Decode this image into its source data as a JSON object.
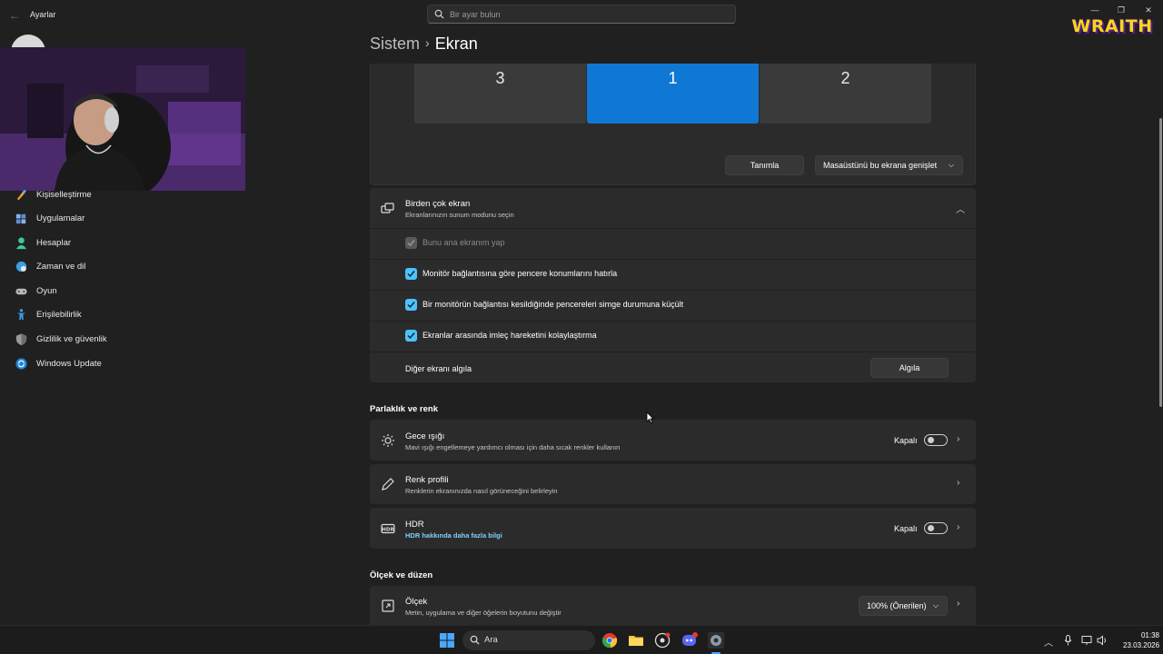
{
  "window": {
    "app_title": "Ayarlar",
    "search_placeholder": "Bir ayar bulun"
  },
  "logo_text": "WRAITH",
  "sidebar": {
    "items": [
      {
        "label": "Kişiselleştirme",
        "icon": "brush-icon"
      },
      {
        "label": "Uygulamalar",
        "icon": "apps-icon"
      },
      {
        "label": "Hesaplar",
        "icon": "person-icon"
      },
      {
        "label": "Zaman ve dil",
        "icon": "globe-clock-icon"
      },
      {
        "label": "Oyun",
        "icon": "gamepad-icon"
      },
      {
        "label": "Erişilebilirlik",
        "icon": "accessibility-icon"
      },
      {
        "label": "Gizlilik ve güvenlik",
        "icon": "shield-icon"
      },
      {
        "label": "Windows Update",
        "icon": "update-icon"
      }
    ]
  },
  "breadcrumb": {
    "parent": "Sistem",
    "separator": "›",
    "current": "Ekran"
  },
  "arrangement": {
    "monitors": [
      {
        "label": "3",
        "active": false
      },
      {
        "label": "1",
        "active": true
      },
      {
        "label": "2",
        "active": false
      }
    ],
    "identify_button": "Tanımla",
    "mode_dropdown": "Masaüstünü bu ekrana genişlet"
  },
  "multi_display": {
    "title": "Birden çok ekran",
    "subtitle": "Ekranlarınızın sunum modunu seçin",
    "options": [
      {
        "label": "Bunu ana ekranım yap",
        "checked": true,
        "disabled": true
      },
      {
        "label": "Monitör bağlantısına göre pencere konumlarını hatırla",
        "checked": true,
        "disabled": false
      },
      {
        "label": "Bir monitörün bağlantısı kesildiğinde pencereleri simge durumuna küçült",
        "checked": true,
        "disabled": false
      },
      {
        "label": "Ekranlar arasında imleç hareketini kolaylaştırma",
        "checked": true,
        "disabled": false
      }
    ],
    "detect_label": "Diğer ekranı algıla",
    "detect_button": "Algıla"
  },
  "brightness_section": {
    "title": "Parlaklık ve renk",
    "night_light": {
      "title": "Gece ışığı",
      "subtitle": "Mavi ışığı engellemeye yardımcı olması için daha sıcak renkler kullanın",
      "state": "Kapalı"
    },
    "color_profile": {
      "title": "Renk profili",
      "subtitle": "Renklerin ekranınızda nasıl görüneceğini belirleyin"
    },
    "hdr": {
      "title": "HDR",
      "link": "HDR hakkında daha fazla bilgi",
      "state": "Kapalı"
    }
  },
  "scale_section": {
    "title": "Ölçek ve düzen",
    "scale": {
      "title": "Ölçek",
      "subtitle": "Metin, uygulama ve diğer öğelerin boyutunu değiştir",
      "value": "100% (Önerilen)"
    }
  },
  "taskbar": {
    "search_label": "Ara",
    "time": "01:38",
    "date": "23.03.2026"
  }
}
